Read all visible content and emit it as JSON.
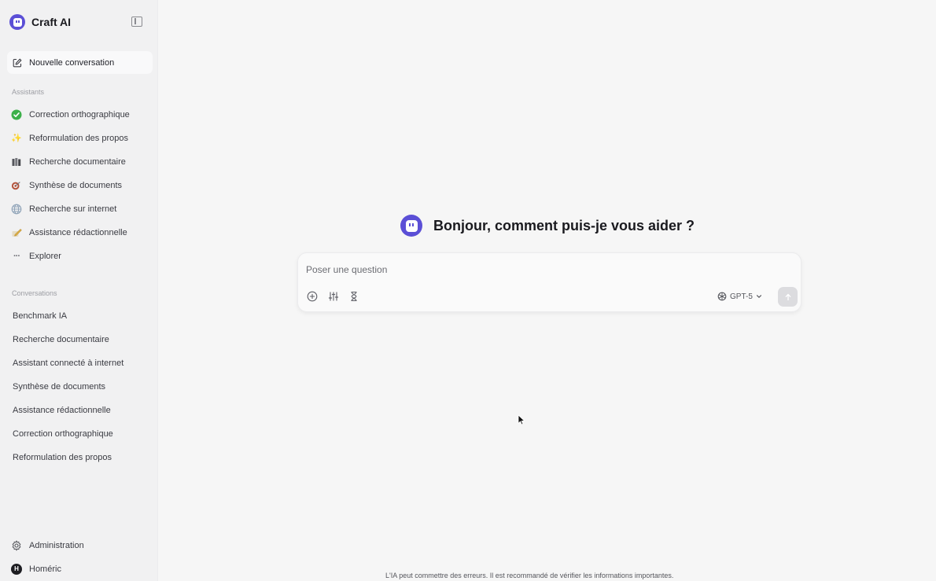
{
  "app": {
    "name": "Craft AI"
  },
  "sidebar": {
    "new_conversation": "Nouvelle conversation",
    "assistants_label": "Assistants",
    "assistants": [
      {
        "label": "Correction orthographique",
        "icon": "check-mark-icon"
      },
      {
        "label": "Reformulation des propos",
        "icon": "sparkles-icon"
      },
      {
        "label": "Recherche documentaire",
        "icon": "books-icon"
      },
      {
        "label": "Synthèse de documents",
        "icon": "target-icon"
      },
      {
        "label": "Recherche sur internet",
        "icon": "globe-icon"
      },
      {
        "label": "Assistance rédactionnelle",
        "icon": "pencil-icon"
      },
      {
        "label": "Explorer",
        "icon": "ellipsis-icon"
      }
    ],
    "conversations_label": "Conversations",
    "conversations": [
      "Benchmark IA",
      "Recherche documentaire",
      "Assistant connecté à internet",
      "Synthèse de documents",
      "Assistance rédactionnelle",
      "Correction orthographique",
      "Reformulation des propos"
    ],
    "admin": "Administration",
    "user": {
      "name": "Homéric",
      "initial": "H"
    }
  },
  "main": {
    "greeting": "Bonjour, comment puis-je vous aider ?",
    "composer": {
      "placeholder": "Poser une question",
      "model": "GPT-5"
    },
    "disclaimer": "L'IA peut commettre des erreurs. Il est recommandé de vérifier les informations importantes."
  },
  "colors": {
    "brand": "#5b4fd6",
    "sidebar_bg": "#f1f1f2",
    "main_bg": "#f6f6f6"
  }
}
